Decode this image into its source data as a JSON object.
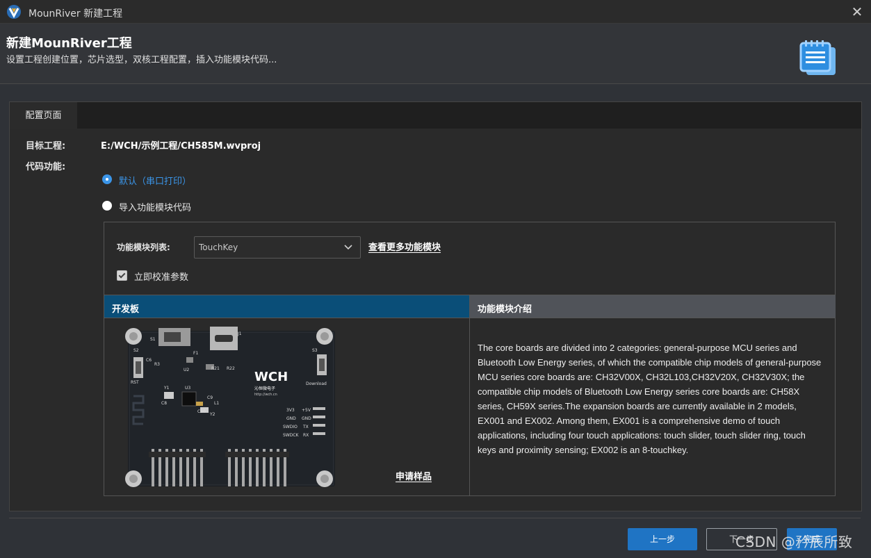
{
  "window": {
    "title": "MounRiver 新建工程",
    "close_icon": "close-icon"
  },
  "header": {
    "title": "新建MounRiver工程",
    "subtitle": "设置工程创建位置，芯片选型，双核工程配置，插入功能模块代码..."
  },
  "tabs": [
    {
      "label": "配置页面",
      "active": true
    }
  ],
  "form": {
    "target_label": "目标工程:",
    "target_value": "E:/WCH/示例工程/CH585M.wvproj",
    "code_label": "代码功能:",
    "radio_default": "默认（串口打印）",
    "radio_import": "导入功能模块代码",
    "selected_radio": "default"
  },
  "module": {
    "list_label": "功能模块列表:",
    "selected": "TouchKey",
    "more_link": "查看更多功能模块",
    "calibrate_label": "立即校准参数",
    "calibrate_checked": true
  },
  "columns": {
    "board": "开发板",
    "intro": "功能模块介绍"
  },
  "board": {
    "sample_link": "申请样品",
    "silk": {
      "brand": "WCH",
      "brand_cn": "沁恒微电子",
      "url": "http://wch.cn",
      "s1": "S1",
      "s2": "S2",
      "s3": "S3",
      "rst": "RST",
      "download": "Download",
      "pins": [
        "3V3",
        "GND",
        "SWDIO",
        "SWDCK"
      ],
      "pins2": [
        "+5V",
        "GND",
        "TX",
        "RX"
      ],
      "u2": "U2",
      "u3": "U3",
      "y1": "Y1",
      "y2": "Y2",
      "j1": "J1",
      "f1": "F1",
      "c6": "C6",
      "r3": "R3",
      "c8": "C8",
      "r22": "R22",
      "r21": "R21",
      "c9": "C9",
      "l1": "L1",
      "c10": "C10"
    }
  },
  "description": "The core boards are divided into 2 categories: general-purpose MCU series and Bluetooth Low Energy series, of which the compatible chip models of general-purpose MCU series core boards are: CH32V00X, CH32L103,CH32V20X, CH32V30X; the compatible chip models of Bluetooth Low Energy series core boards are: CH58X series, CH59X series.The expansion boards are currently available in 2 models, EX001 and EX002. Among them, EX001 is a comprehensive demo of touch applications, including four touch applications: touch slider, touch slider ring, touch keys and proximity sensing; EX002 is an 8-touchkey.",
  "footer": {
    "prev": "上一步",
    "next": "下一步",
    "finish": "完成"
  },
  "watermark": "CSDN @矜辰所致",
  "colors": {
    "accent": "#1f74c4",
    "header_blue": "#0a4e78",
    "radio": "#3b95e8"
  }
}
